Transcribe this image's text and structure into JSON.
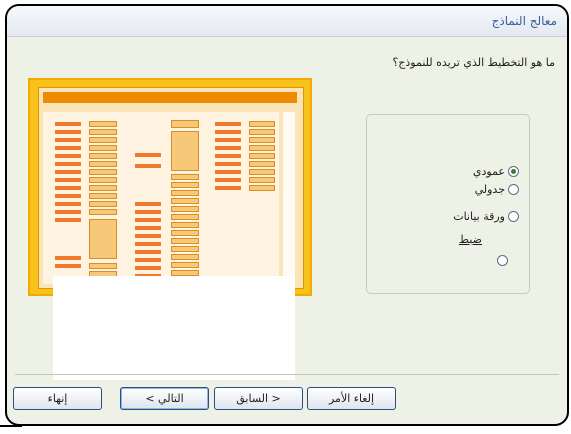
{
  "window": {
    "title": "معالج النماذج"
  },
  "question": "ما هو التخطيط الذي تريده للنموذج؟",
  "layout_options": [
    {
      "label": "عمودي",
      "selected": true
    },
    {
      "label": "جدولي",
      "selected": false
    },
    {
      "label": "ورقة بيانات",
      "selected": false
    },
    {
      "label": "ضبط",
      "selected": false
    }
  ],
  "buttons": {
    "cancel": "إلغاء الأمر",
    "back": "< السابق",
    "next": "التالي >",
    "finish": "إنهاء"
  },
  "colors": {
    "preview_frame": "#f8c21a",
    "preview_header": "#ee8a00",
    "label_bar": "#f07b2f",
    "field_box": "#f7c878"
  }
}
